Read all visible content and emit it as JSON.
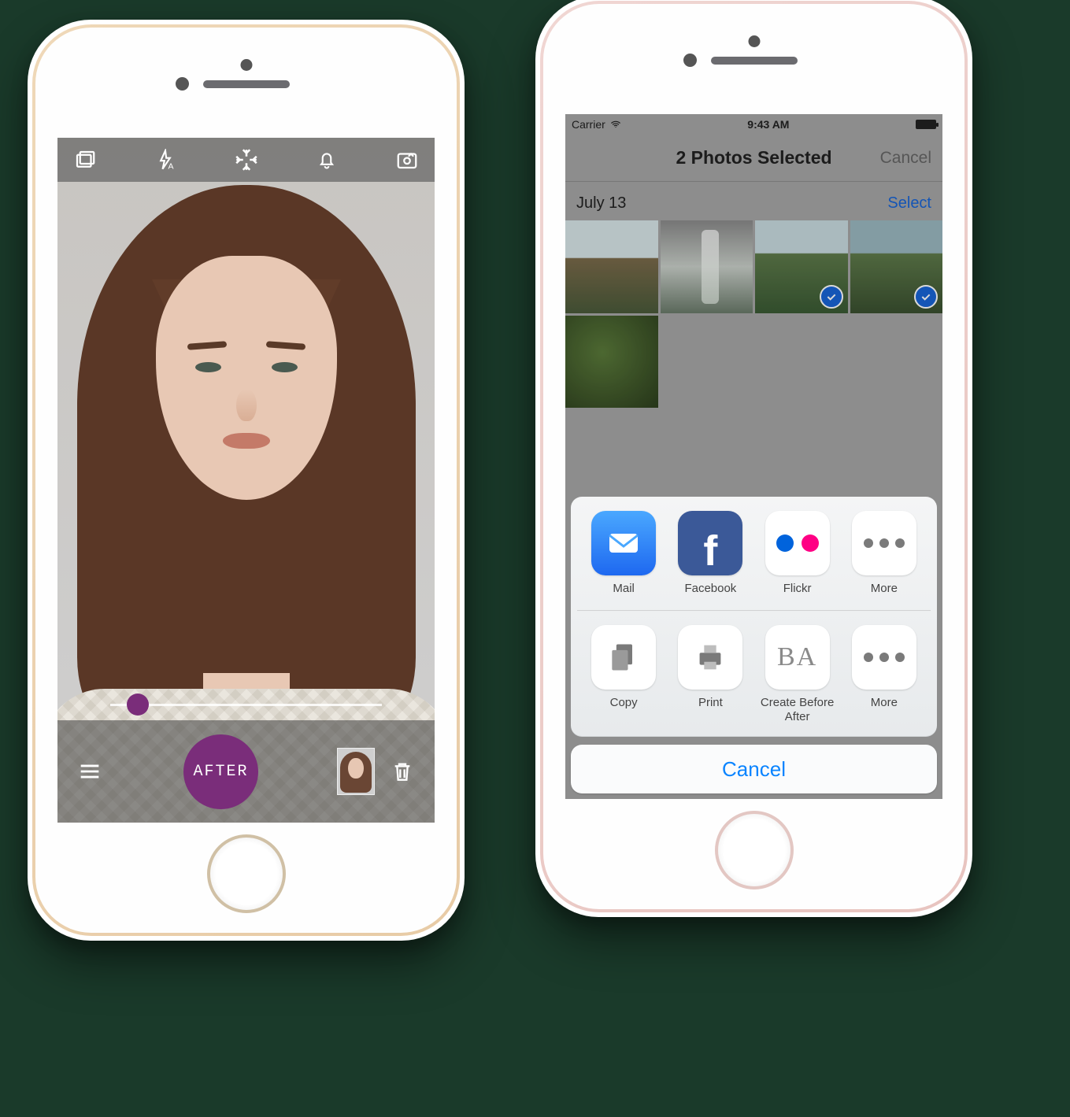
{
  "left_phone": {
    "toolbar_icons": [
      "gallery-icon",
      "flash-icon",
      "focus-icon",
      "bell-icon",
      "switch-camera-icon"
    ],
    "shutter_label": "AFTER",
    "slider_value": 10
  },
  "right_phone": {
    "status": {
      "carrier": "Carrier",
      "time": "9:43 AM"
    },
    "nav": {
      "title": "2 Photos Selected",
      "cancel": "Cancel"
    },
    "section": {
      "date": "July 13",
      "select": "Select"
    },
    "photos": [
      {
        "kind": "landscape1",
        "selected": false
      },
      {
        "kind": "waterfall",
        "selected": false
      },
      {
        "kind": "hillside",
        "selected": true
      },
      {
        "kind": "valley",
        "selected": true
      },
      {
        "kind": "jungle",
        "selected": false
      }
    ],
    "share_sheet": {
      "row1": [
        {
          "id": "mail",
          "label": "Mail"
        },
        {
          "id": "fb",
          "label": "Facebook"
        },
        {
          "id": "flickr",
          "label": "Flickr"
        },
        {
          "id": "more",
          "label": "More"
        }
      ],
      "row2": [
        {
          "id": "copy",
          "label": "Copy"
        },
        {
          "id": "print",
          "label": "Print"
        },
        {
          "id": "ba",
          "label": "Create Before After"
        },
        {
          "id": "more2",
          "label": "More"
        }
      ],
      "cancel": "Cancel"
    }
  }
}
